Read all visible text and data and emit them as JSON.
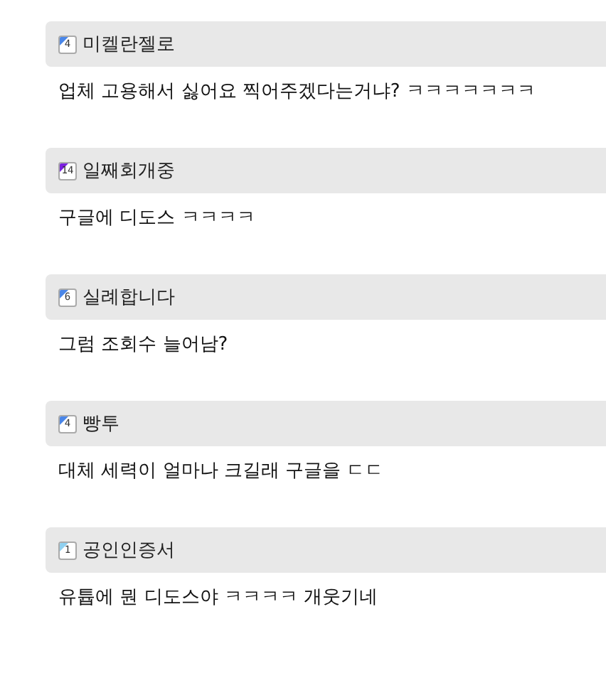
{
  "comments": [
    {
      "author": "미켈란젤로",
      "level": "4",
      "color": "#4a86e8",
      "text": "업체 고용해서 싫어요 찍어주겠다는거냐? ㅋㅋㅋㅋㅋㅋㅋ"
    },
    {
      "author": "일째회개중",
      "level": "14",
      "color": "#7b1fe0",
      "text": "구글에 디도스 ㅋㅋㅋㅋ"
    },
    {
      "author": "실례합니다",
      "level": "6",
      "color": "#4a86e8",
      "text": "그럼 조회수 늘어남?"
    },
    {
      "author": "빵투",
      "level": "4",
      "color": "#4a86e8",
      "text": "대체 세력이 얼마나 크길래 구글을 ㄷㄷ"
    },
    {
      "author": "공인인증서",
      "level": "1",
      "color": "#8fd0f0",
      "text": "유튭에 뭔 디도스야 ㅋㅋㅋㅋ 개웃기네"
    }
  ]
}
